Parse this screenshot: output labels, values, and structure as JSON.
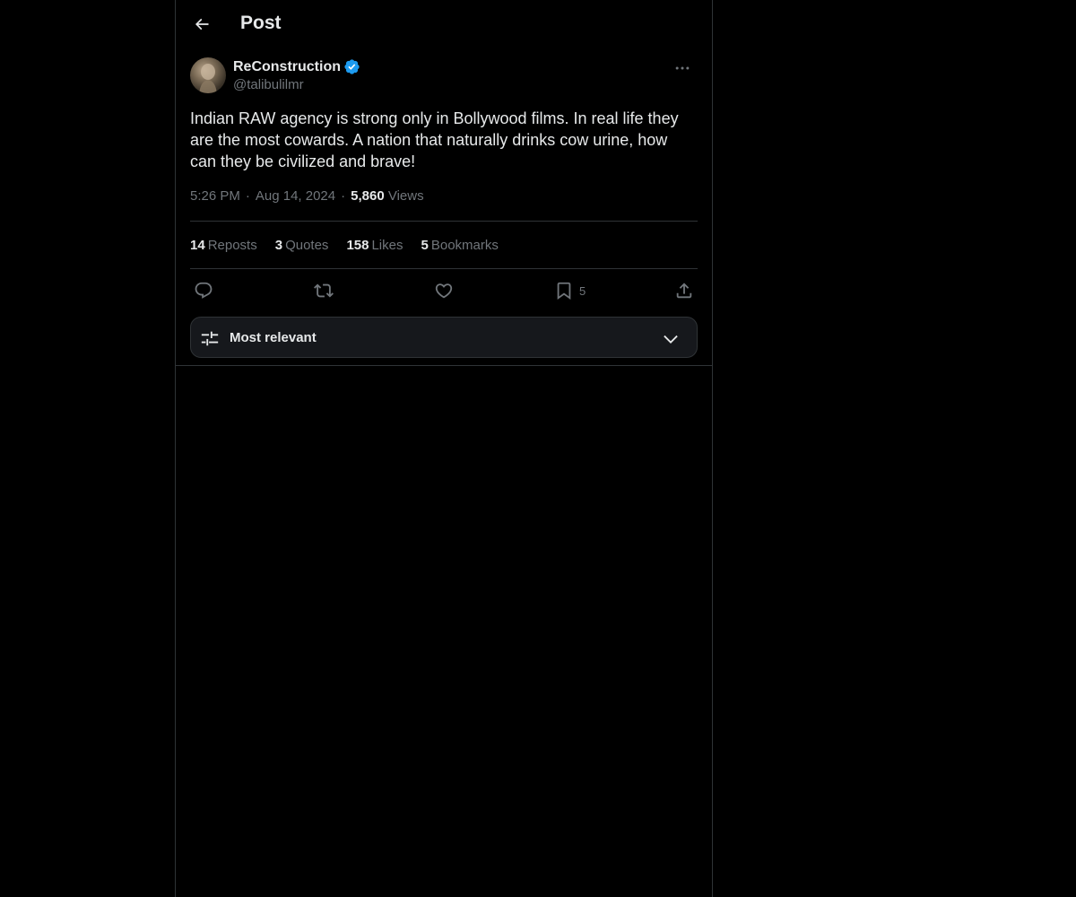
{
  "header": {
    "title": "Post"
  },
  "author": {
    "name": "ReConstruction",
    "handle": "@talibulilmr"
  },
  "post": {
    "text": "Indian RAW agency is strong only in Bollywood films. In real life they are the most cowards. A nation that naturally drinks cow urine, how can they be civilized and brave!",
    "time": "5:26 PM",
    "date": "Aug 14, 2024",
    "views_count": "5,860",
    "views_label": "Views"
  },
  "stats": {
    "reposts": {
      "count": "14",
      "label": "Reposts"
    },
    "quotes": {
      "count": "3",
      "label": "Quotes"
    },
    "likes": {
      "count": "158",
      "label": "Likes"
    },
    "bookmarks": {
      "count": "5",
      "label": "Bookmarks"
    }
  },
  "actions": {
    "reply_icon": "reply-icon",
    "repost_icon": "repost-icon",
    "like_icon": "heart-icon",
    "bookmark_icon": "bookmark-icon",
    "bookmark_count": "5",
    "share_icon": "share-icon"
  },
  "sort": {
    "label": "Most relevant"
  },
  "colors": {
    "background": "#000000",
    "text_primary": "#e7e9ea",
    "text_secondary": "#71767b",
    "border": "#2f3336",
    "verified": "#1d9bf0"
  }
}
